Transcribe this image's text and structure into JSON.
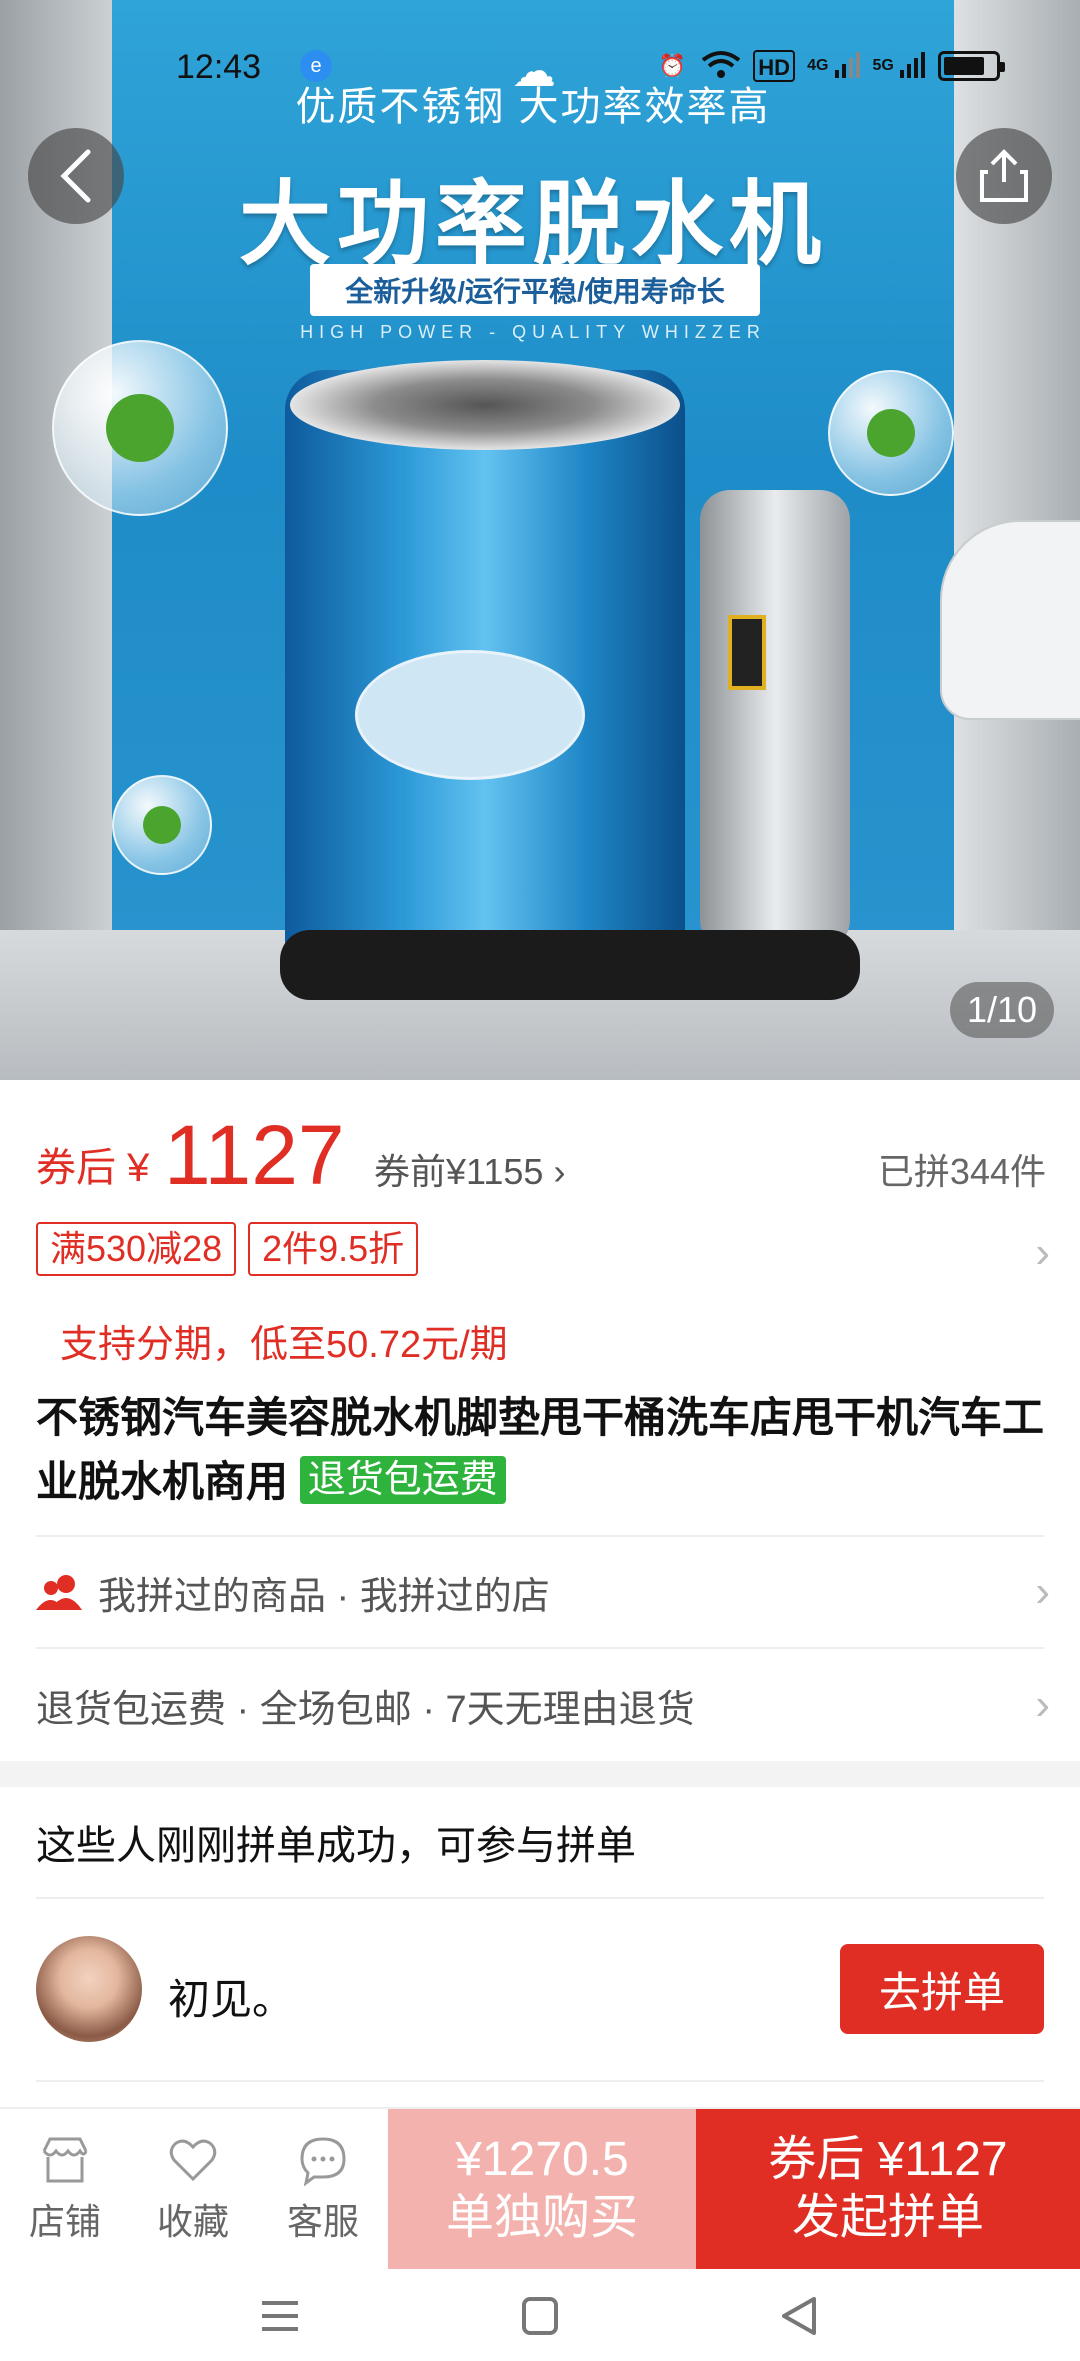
{
  "status_bar": {
    "time": "12:43",
    "hd_label": "HD",
    "net1": "4G",
    "net2": "5G"
  },
  "hero": {
    "poster_line1": "优质不锈钢  大功率效率高",
    "poster_title": "大功率脱水机",
    "poster_subtitle": "全新升级/运行平稳/使用寿命长",
    "poster_english": "HIGH POWER - QUALITY WHIZZER",
    "image_counter": "1/10"
  },
  "price": {
    "after_label": "券后",
    "currency": "¥",
    "after_value": "1127",
    "before_text": "券前¥1155",
    "sold_text": "已拼344件"
  },
  "tags": [
    "满530减28",
    "2件9.5折"
  ],
  "installment": "支持分期，低至50.72元/期",
  "title": {
    "text": "不锈钢汽车美容脱水机脚垫甩干桶洗车店甩干机汽车工业脱水机商用",
    "badge": "退货包运费"
  },
  "rows": {
    "history": "我拼过的商品 · 我拼过的店",
    "service": "退货包运费 · 全场包邮 · 7天无理由退货"
  },
  "group": {
    "heading": "这些人刚刚拼单成功，可参与拼单",
    "username": "初见。",
    "join_button": "去拼单"
  },
  "bottom_bar": {
    "shop": "店铺",
    "favorite": "收藏",
    "service": "客服",
    "buy_alone_price": "¥1270.5",
    "buy_alone_label": "单独购买",
    "buy_group_price": "券后 ¥1127",
    "buy_group_label": "发起拼单"
  },
  "colors": {
    "accent_red": "#e02e24",
    "light_red": "#f4b2ae",
    "badge_green": "#2eb33c"
  }
}
